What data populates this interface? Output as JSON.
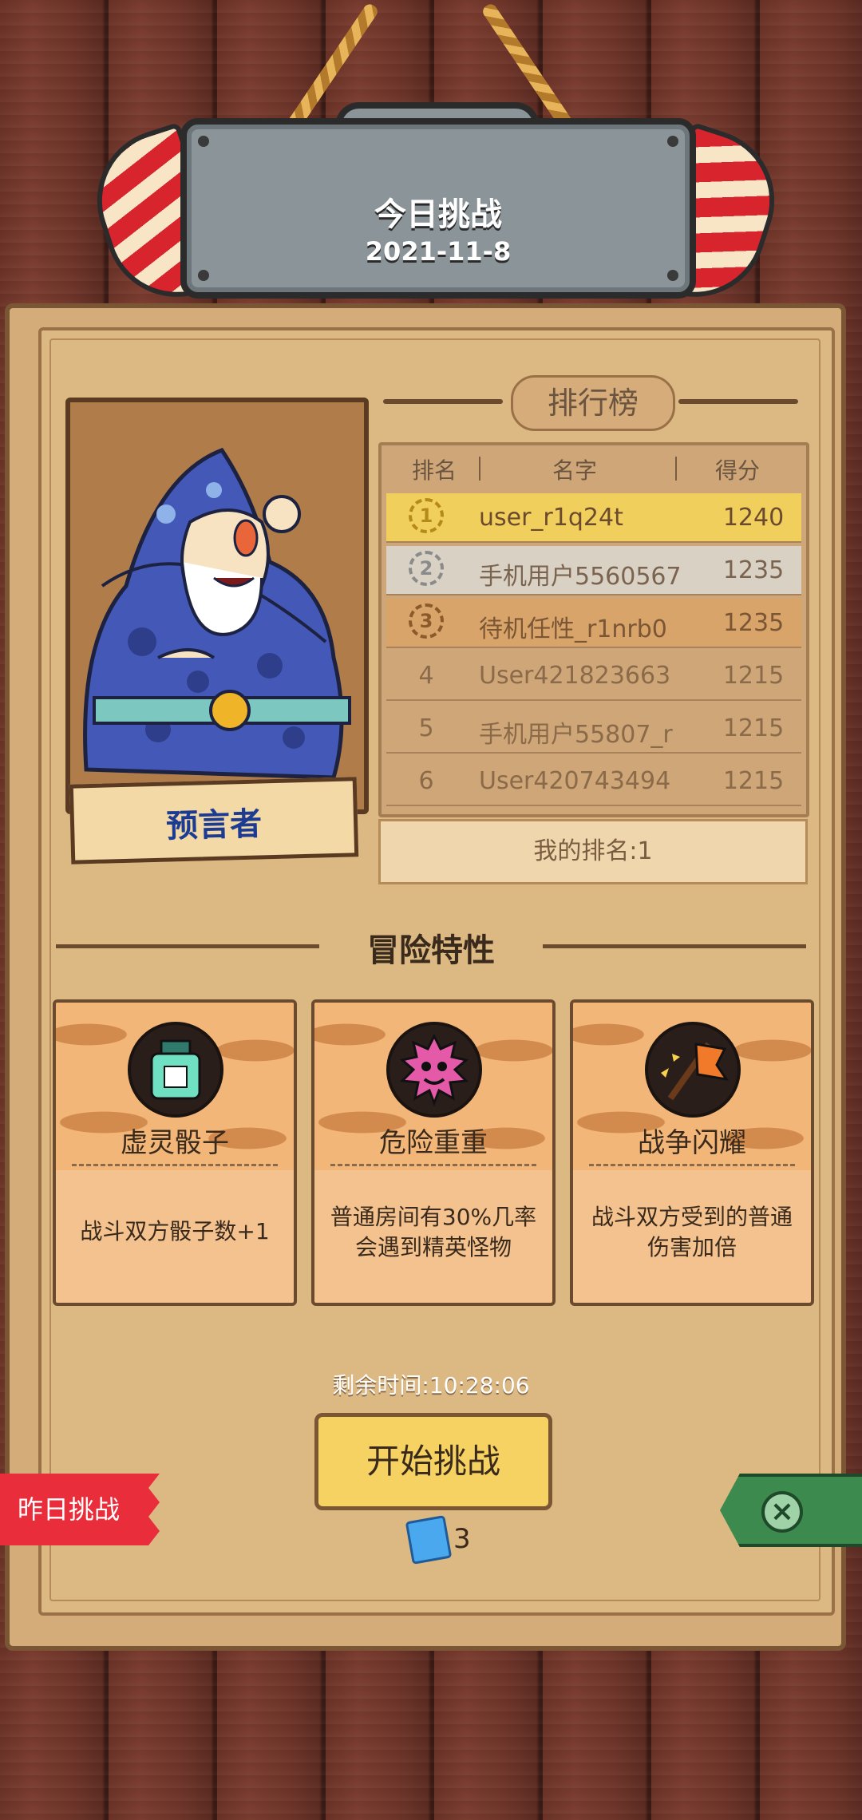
{
  "header": {
    "title": "今日挑战",
    "date": "2021-11-8"
  },
  "character": {
    "name": "预言者"
  },
  "leaderboard": {
    "title": "排行榜",
    "columns": {
      "rank": "排名",
      "name": "名字",
      "score": "得分"
    },
    "rows": [
      {
        "rank": "1",
        "name": "user_r1q24t",
        "score": "1240"
      },
      {
        "rank": "2",
        "name": "手机用户5560567",
        "score": "1235"
      },
      {
        "rank": "3",
        "name": "待机任性_r1nrb0",
        "score": "1235"
      },
      {
        "rank": "4",
        "name": "User421823663",
        "score": "1215"
      },
      {
        "rank": "5",
        "name": "手机用户55807_r",
        "score": "1215"
      },
      {
        "rank": "6",
        "name": "User420743494",
        "score": "1215"
      }
    ],
    "my_rank": "我的排名:1"
  },
  "traits": {
    "title": "冒险特性",
    "cards": [
      {
        "name": "虚灵骰子",
        "desc": "战斗双方骰子数+1",
        "icon": "bottle-icon"
      },
      {
        "name": "危险重重",
        "desc": "普通房间有30%几率会遇到精英怪物",
        "icon": "demon-icon"
      },
      {
        "name": "战争闪耀",
        "desc": "战斗双方受到的普通伤害加倍",
        "icon": "war-banner-icon"
      }
    ]
  },
  "bottom": {
    "timer": "剩余时间:10:28:06",
    "start_label": "开始挑战",
    "ticket_count": "3",
    "yesterday_label": "昨日挑战"
  },
  "colors": {
    "gold_row": "#f1cf5d",
    "silver_row": "#d9d1c4",
    "bronze_row": "#d9a46a",
    "accent_red": "#ea2d3a",
    "accent_green": "#3d8a4e"
  }
}
